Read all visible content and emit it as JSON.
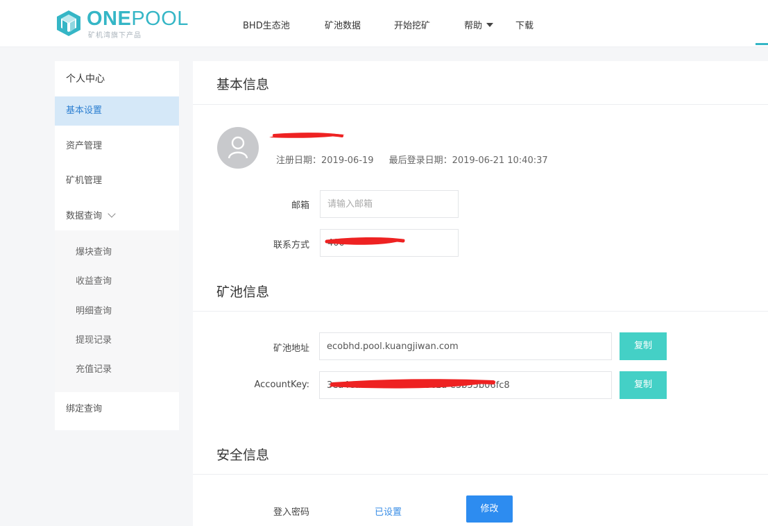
{
  "header": {
    "logo_bold": "ONE",
    "logo_light": "POOL",
    "logo_sub": "矿机湾旗下产品",
    "nav": [
      "BHD生态池",
      "矿池数据",
      "开始挖矿",
      "帮助",
      "下载"
    ],
    "accent_color": "#35b6c6"
  },
  "sidebar": {
    "title": "个人中心",
    "items": [
      "基本设置",
      "资产管理",
      "矿机管理",
      "数据查询"
    ],
    "sub_items": [
      "爆块查询",
      "收益查询",
      "明细查询",
      "提现记录",
      "充值记录"
    ],
    "bottom_item": "绑定查询",
    "active_item": "基本设置"
  },
  "basic": {
    "title": "基本信息",
    "register_date": "注册日期：2019-06-19",
    "last_login": "最后登录日期：2019-06-21 10:40:37",
    "email_label": "邮箱",
    "email_placeholder": "请输入邮箱",
    "contact_label": "联系方式",
    "contact_value": "400"
  },
  "pool": {
    "title": "矿池信息",
    "address_label": "矿池地址",
    "address_value": "ecobhd.pool.kuangjiwan.com",
    "key_label": "AccountKey:",
    "key_value": "3ea4ea40-fb42-d83b-3c1a-e3b55b06fc8",
    "copy_label": "复制",
    "button_color": "#44d0c6"
  },
  "security": {
    "title": "安全信息",
    "password_label": "登入密码",
    "status": "已设置",
    "modify_label": "修改",
    "button_color": "#2d8cf0"
  }
}
